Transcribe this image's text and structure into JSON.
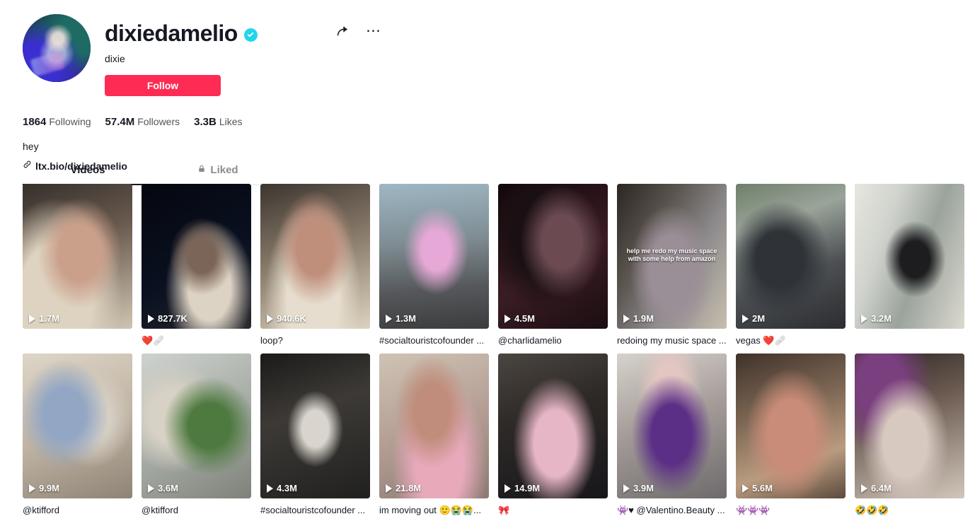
{
  "profile": {
    "username": "dixiedamelio",
    "verified": true,
    "verified_color": "#20D5EC",
    "nickname": "dixie",
    "follow_label": "Follow",
    "follow_color": "#FE2C55",
    "bio": "hey",
    "bio_link": "ltx.bio/dixiedamelio",
    "stats": [
      {
        "value": "1864",
        "label": "Following"
      },
      {
        "value": "57.4M",
        "label": "Followers"
      },
      {
        "value": "3.3B",
        "label": "Likes"
      }
    ],
    "actions": [
      {
        "name": "share-icon",
        "label": "Share"
      },
      {
        "name": "more-icon",
        "label": "⋯"
      }
    ]
  },
  "tabs": [
    {
      "label": "Videos",
      "active": true,
      "locked": false
    },
    {
      "label": "Liked",
      "active": false,
      "locked": true
    }
  ],
  "videos": [
    {
      "plays": "1.7M",
      "caption": "",
      "art": "t1",
      "overlay": ""
    },
    {
      "plays": "827.7K",
      "caption": "❤️🩹",
      "art": "t2",
      "overlay": ""
    },
    {
      "plays": "940.6K",
      "caption": "loop?",
      "art": "t3",
      "overlay": ""
    },
    {
      "plays": "1.3M",
      "caption": "#socialtouristcofounder ...",
      "art": "t4",
      "overlay": ""
    },
    {
      "plays": "4.5M",
      "caption": "@charlidamelio",
      "art": "t5",
      "overlay": ""
    },
    {
      "plays": "1.9M",
      "caption": "redoing my music space ...",
      "art": "t6",
      "overlay": "help me redo my music space with some help from amazon"
    },
    {
      "plays": "2M",
      "caption": "vegas ❤️🩹",
      "art": "t7",
      "overlay": ""
    },
    {
      "plays": "3.2M",
      "caption": "",
      "art": "t8",
      "overlay": ""
    },
    {
      "plays": "9.9M",
      "caption": "@ktifford",
      "art": "t9",
      "overlay": ""
    },
    {
      "plays": "3.6M",
      "caption": "@ktifford",
      "art": "t10",
      "overlay": ""
    },
    {
      "plays": "4.3M",
      "caption": "#socialtouristcofounder ...",
      "art": "t11",
      "overlay": ""
    },
    {
      "plays": "21.8M",
      "caption": "im moving out 🙂😭😭...",
      "art": "t12",
      "overlay": ""
    },
    {
      "plays": "14.9M",
      "caption": "🎀",
      "art": "t13",
      "overlay": ""
    },
    {
      "plays": "3.9M",
      "caption": "👾♥ @Valentino.Beauty ...",
      "art": "t14",
      "overlay": ""
    },
    {
      "plays": "5.6M",
      "caption": "👾👾👾",
      "art": "t15",
      "overlay": ""
    },
    {
      "plays": "6.4M",
      "caption": "🤣🤣🤣",
      "art": "t16",
      "overlay": ""
    }
  ]
}
